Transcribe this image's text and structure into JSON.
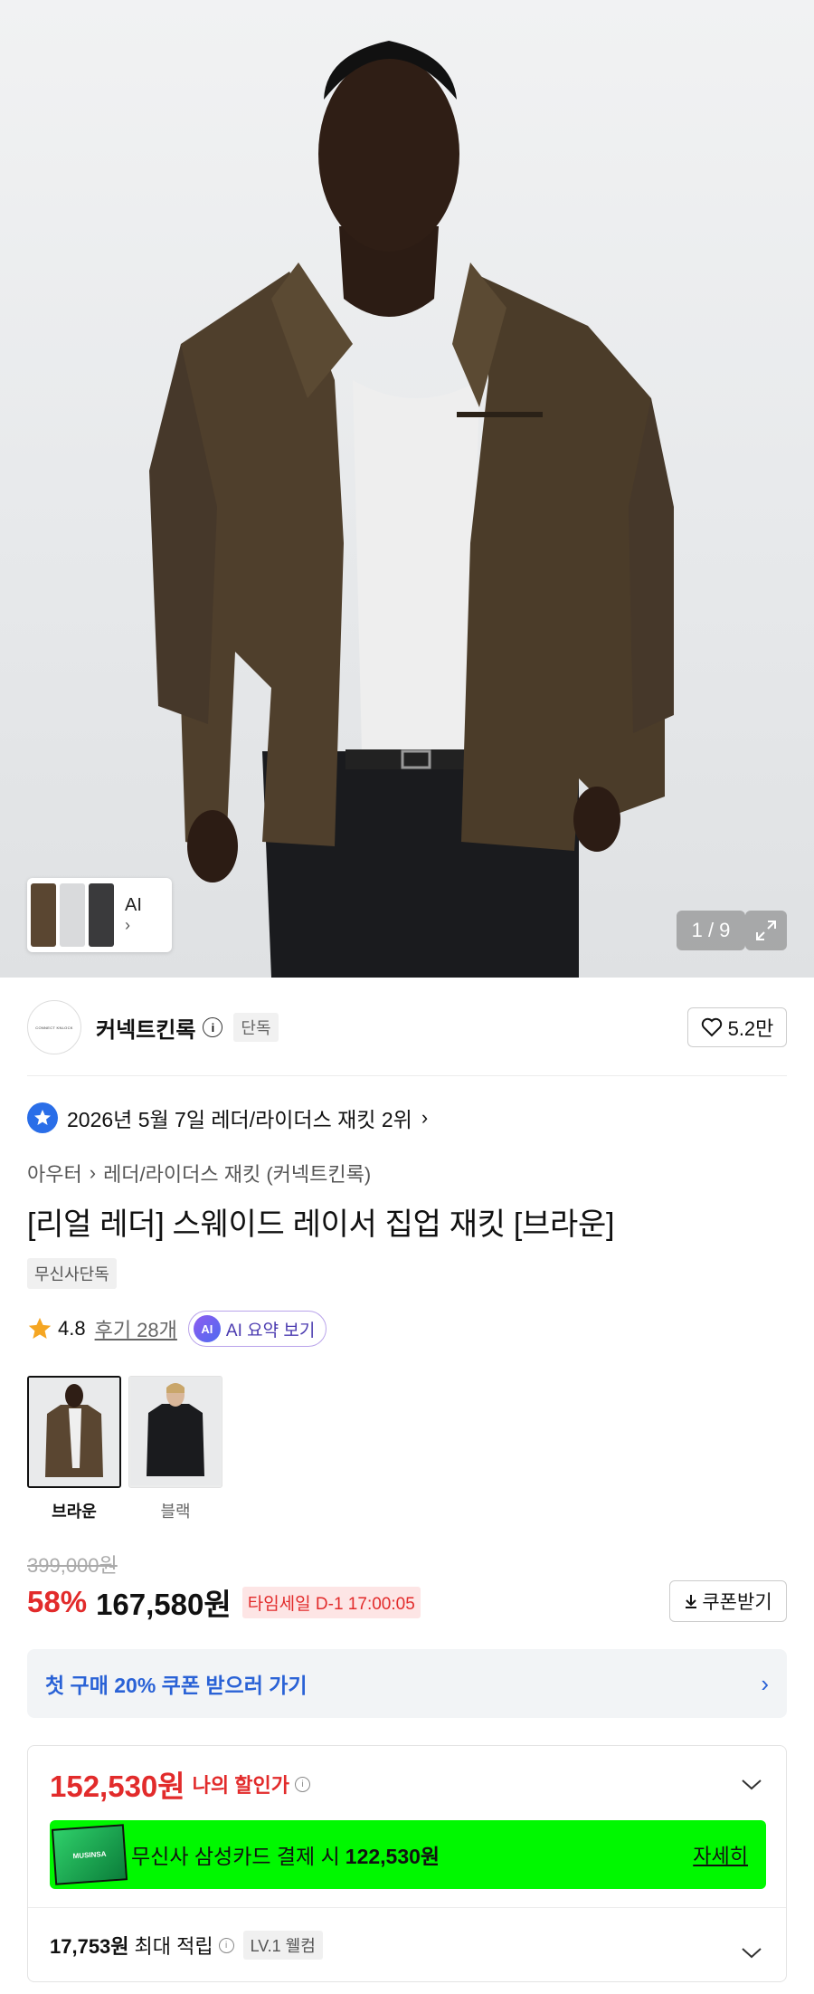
{
  "gallery": {
    "counter": "1 / 9",
    "ai_label": "AI",
    "ai_chevron": "›"
  },
  "brand": {
    "logo_text": "CONNECT KNLOCK",
    "name": "커넥트킨록",
    "exclusive_tag": "단독",
    "likes": "5.2만"
  },
  "ranking": {
    "text": "2026년 5월 7일 레더/라이더스 재킷 2위",
    "chevron": "›"
  },
  "breadcrumb": {
    "category": "아우터",
    "separator": "›",
    "subcategory": "레더/라이더스 재킷 (커넥트킨록)"
  },
  "product": {
    "title": "[리얼 레더] 스웨이드 레이서 집업 재킷 [브라운]",
    "badge": "무신사단독"
  },
  "rating": {
    "score": "4.8",
    "reviews": "후기 28개",
    "ai_badge": "AI",
    "ai_summary": "AI 요약 보기"
  },
  "colors": [
    {
      "label": "브라운",
      "selected": true
    },
    {
      "label": "블랙",
      "selected": false
    }
  ],
  "pricing": {
    "original": "399,000원",
    "discount": "58%",
    "price": "167,580원",
    "timesale": "타임세일 D-1 17:00:05",
    "coupon_button": "쿠폰받기"
  },
  "first_purchase": {
    "text": "첫 구매 20% 쿠폰 받으러 가기",
    "chevron": "›"
  },
  "my_price": {
    "amount": "152,530원",
    "label": "나의 할인가",
    "card_logo_text": "MUSINSA",
    "card_text": "무신사 삼성카드 결제 시",
    "card_amount": "122,530원",
    "card_detail": "자세히",
    "points_amount": "17,753원",
    "points_label": "최대 적립",
    "level_tag": "LV.1 웰컴"
  },
  "colors_theme": {
    "accent_red": "#e22b2b",
    "accent_blue": "#2a62d6",
    "card_green": "#00f800"
  }
}
